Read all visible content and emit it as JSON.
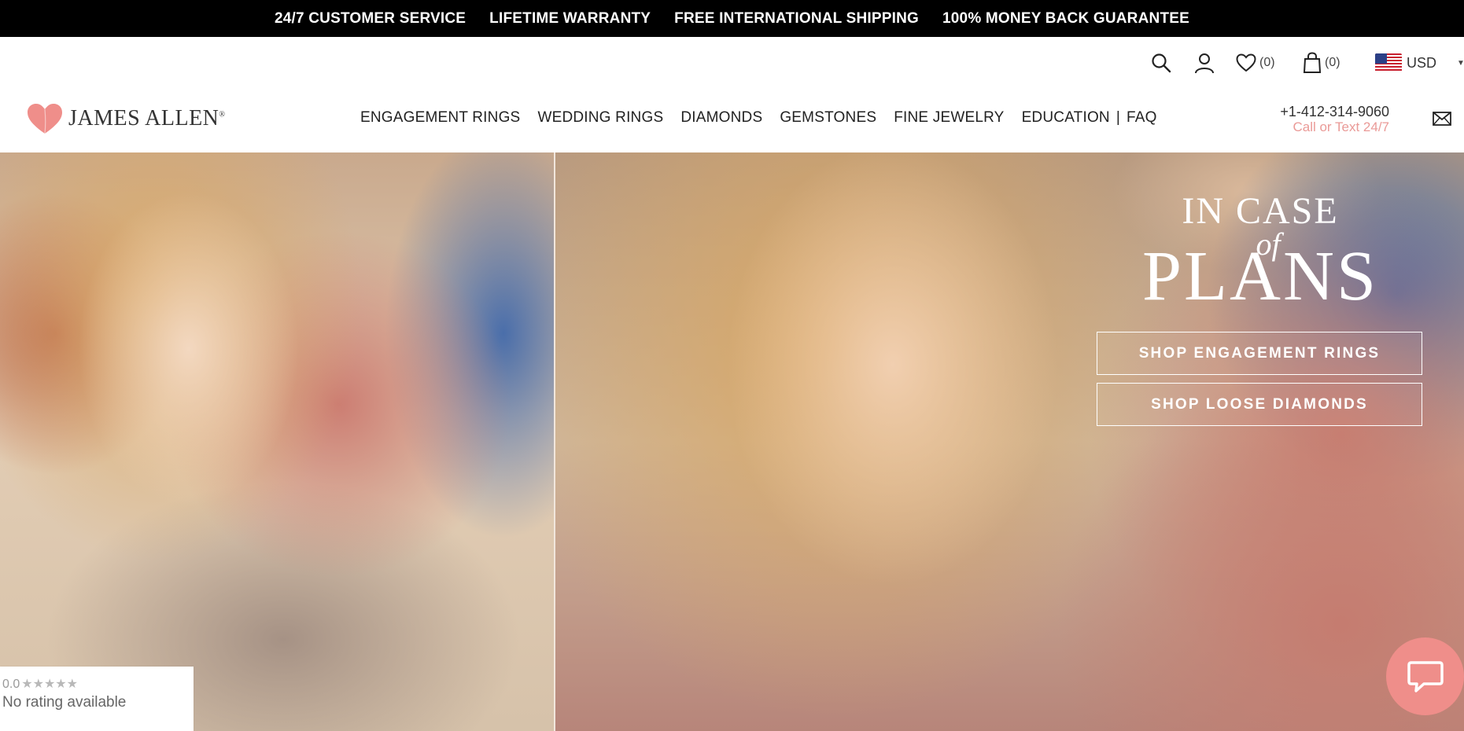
{
  "topbar": {
    "items": [
      "24/7 CUSTOMER SERVICE",
      "LIFETIME WARRANTY",
      "FREE INTERNATIONAL SHIPPING",
      "100% MONEY BACK GUARANTEE"
    ]
  },
  "header": {
    "logo_text": "JAMES ALLEN",
    "logo_mark": "®",
    "wishlist_count": "(0)",
    "cart_count": "(0)",
    "currency": "USD",
    "nav": [
      "ENGAGEMENT RINGS",
      "WEDDING RINGS",
      "DIAMONDS",
      "GEMSTONES",
      "FINE JEWELRY",
      "EDUCATION"
    ],
    "nav_separator": "|",
    "nav_faq": "FAQ",
    "phone": "+1-412-314-9060",
    "phone_sub": "Call or Text 24/7",
    "colors": {
      "accent_pink": "#ea9a97",
      "topbar_bg": "#000000"
    }
  },
  "hero": {
    "headline_1": "IN CASE",
    "headline_2": "of",
    "headline_3": "PLANS",
    "cta_engagement": "SHOP ENGAGEMENT RINGS",
    "cta_diamonds": "SHOP LOOSE DIAMONDS"
  },
  "rating_widget": {
    "score": "0.0",
    "stars": "★★★★★",
    "status": "No rating available"
  },
  "icons": [
    "search-icon",
    "account-icon",
    "heart-icon",
    "bag-icon",
    "us-flag-icon",
    "mail-icon",
    "chat-icon"
  ]
}
